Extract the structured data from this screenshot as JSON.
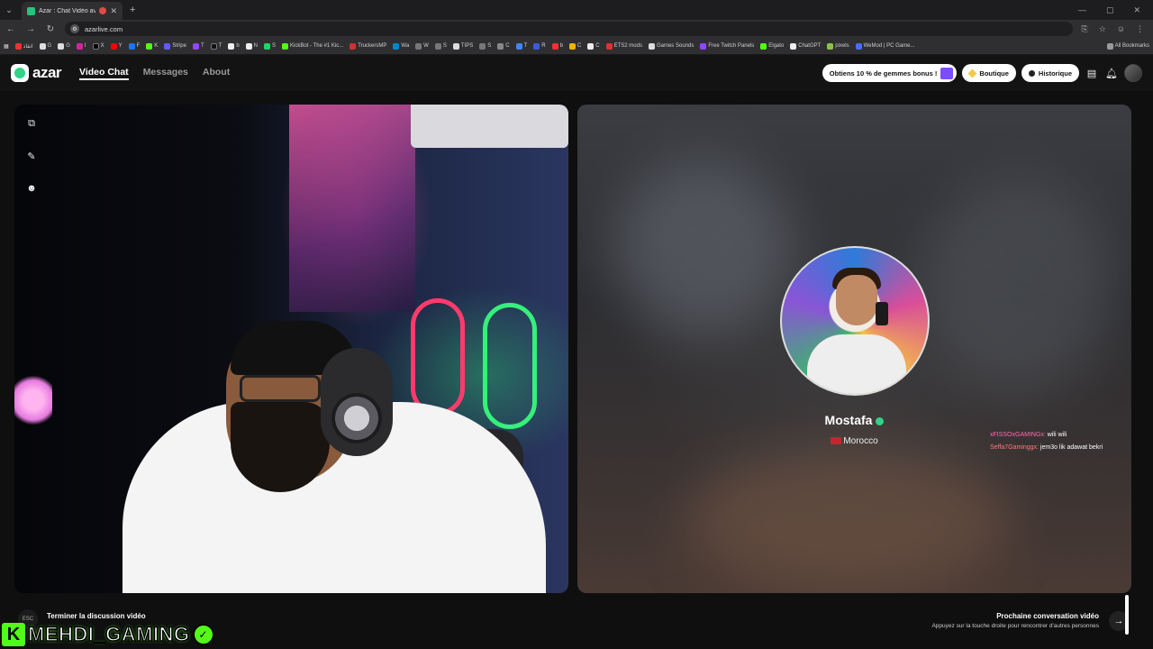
{
  "browser": {
    "tab_title": "Azar : Chat Vidéo avec de ...",
    "url": "azarlive.com",
    "bookmarks": [
      "انقاذ",
      "G",
      "G",
      "I",
      "X",
      "Y",
      "F",
      "K",
      "Stripe",
      "T",
      "T",
      "b",
      "N",
      "S",
      "KickBot - The #1 Kic...",
      "TruckersMP",
      "Wa",
      "W",
      "S",
      "TIPS",
      "S",
      "C",
      "T",
      "R",
      "b",
      "C",
      "C",
      "ETS2 mods",
      "Games Sounds",
      "Free Twitch Panels",
      "Elgato",
      "ChatGPT",
      "pixels",
      "WeMod | PC Game..."
    ],
    "all_bookmarks": "All Bookmarks"
  },
  "header": {
    "logo": "azar",
    "nav": [
      "Video Chat",
      "Messages",
      "About"
    ],
    "promo": "Obtiens 10 % de gemmes bonus !",
    "shop": "Boutique",
    "history": "Historique"
  },
  "peer": {
    "name": "Mostafa",
    "country": "Morocco"
  },
  "chat": [
    {
      "user": "xFISSOxGAMINGx:",
      "text": "wili wili"
    },
    {
      "user": "Seffa7Gaminggx:",
      "text": "jem3o lik adawat bekri"
    }
  ],
  "footer": {
    "end_label": "Terminer la discussion vidéo",
    "end_key": "ESC",
    "next_title": "Prochaine conversation vidéo",
    "next_sub": "Appuyez sur la touche droite pour rencontrer d'autres personnes"
  },
  "overlay": {
    "k": "K",
    "name": "MEHDI_GAMING"
  },
  "colors": {
    "accent": "#2fd487",
    "kick": "#53fc18"
  }
}
